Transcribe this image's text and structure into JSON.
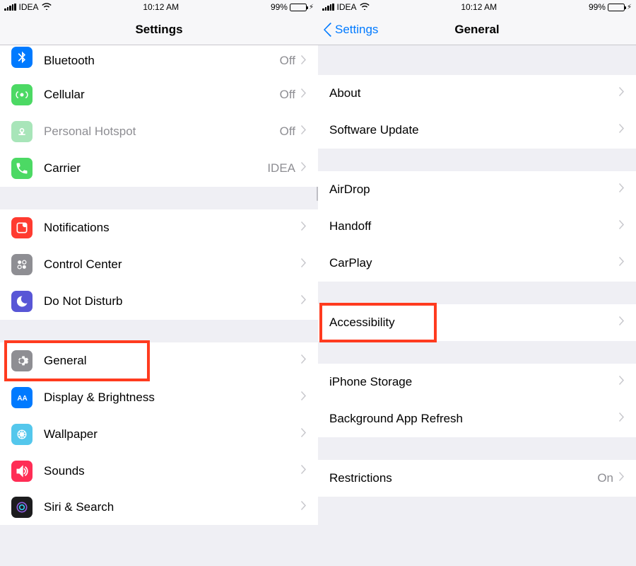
{
  "status": {
    "carrier": "IDEA",
    "time": "10:12 AM",
    "battery_pct": "99%"
  },
  "left": {
    "title": "Settings",
    "rows": [
      {
        "name": "bluetooth",
        "label": "Bluetooth",
        "detail": "Off",
        "cutoff": "top"
      },
      {
        "name": "cellular",
        "label": "Cellular",
        "detail": "Off"
      },
      {
        "name": "hotspot",
        "label": "Personal Hotspot",
        "detail": "Off",
        "muted": true
      },
      {
        "name": "carrier",
        "label": "Carrier",
        "detail": "IDEA"
      }
    ],
    "rows2": [
      {
        "name": "notifications",
        "label": "Notifications"
      },
      {
        "name": "control-center",
        "label": "Control Center"
      },
      {
        "name": "dnd",
        "label": "Do Not Disturb"
      }
    ],
    "rows3": [
      {
        "name": "general",
        "label": "General",
        "highlighted": true
      },
      {
        "name": "display",
        "label": "Display & Brightness"
      },
      {
        "name": "wallpaper",
        "label": "Wallpaper"
      },
      {
        "name": "sounds",
        "label": "Sounds"
      },
      {
        "name": "siri",
        "label": "Siri & Search",
        "cutoff": "bottom"
      }
    ]
  },
  "right": {
    "back_label": "Settings",
    "title": "General",
    "gA": [
      {
        "name": "about",
        "label": "About"
      },
      {
        "name": "software-update",
        "label": "Software Update"
      }
    ],
    "gB": [
      {
        "name": "airdrop",
        "label": "AirDrop"
      },
      {
        "name": "handoff",
        "label": "Handoff"
      },
      {
        "name": "carplay",
        "label": "CarPlay"
      }
    ],
    "gC": [
      {
        "name": "accessibility",
        "label": "Accessibility",
        "highlighted": true
      }
    ],
    "gD": [
      {
        "name": "iphone-storage",
        "label": "iPhone Storage"
      },
      {
        "name": "background-refresh",
        "label": "Background App Refresh"
      }
    ],
    "gE": [
      {
        "name": "restrictions",
        "label": "Restrictions",
        "detail": "On"
      }
    ]
  }
}
